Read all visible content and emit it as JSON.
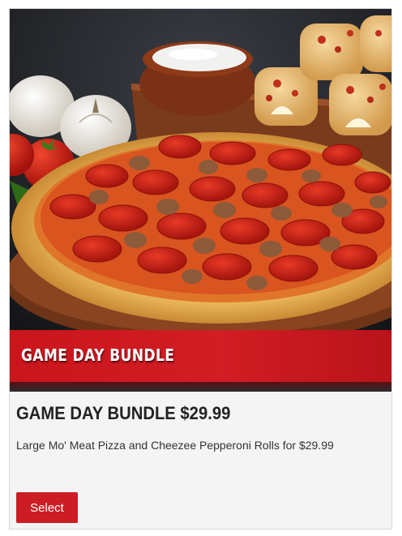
{
  "card": {
    "banner_text": "GAME DAY BUNDLE",
    "title": "GAME DAY BUNDLE $29.99",
    "description": "Large Mo' Meat Pizza and Cheezee Pepperoni Rolls for $29.99",
    "select_label": "Select"
  },
  "colors": {
    "brand_red": "#cc1c24",
    "card_bg": "#f4f4f4"
  }
}
